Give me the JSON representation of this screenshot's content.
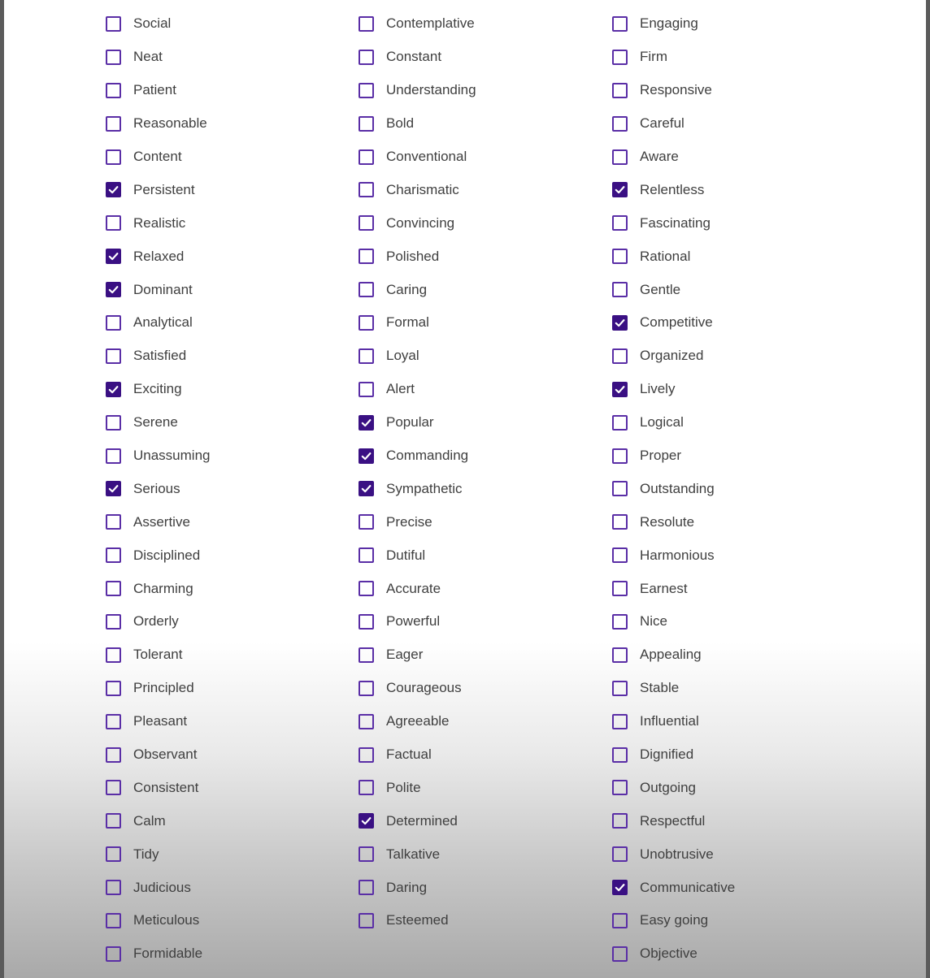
{
  "checklist": {
    "columns": [
      {
        "items": [
          {
            "label": "Social",
            "checked": false
          },
          {
            "label": "Neat",
            "checked": false
          },
          {
            "label": "Patient",
            "checked": false
          },
          {
            "label": "Reasonable",
            "checked": false
          },
          {
            "label": "Content",
            "checked": false
          },
          {
            "label": "Persistent",
            "checked": true
          },
          {
            "label": "Realistic",
            "checked": false
          },
          {
            "label": "Relaxed",
            "checked": true
          },
          {
            "label": "Dominant",
            "checked": true
          },
          {
            "label": "Analytical",
            "checked": false
          },
          {
            "label": "Satisfied",
            "checked": false
          },
          {
            "label": "Exciting",
            "checked": true
          },
          {
            "label": "Serene",
            "checked": false
          },
          {
            "label": "Unassuming",
            "checked": false
          },
          {
            "label": "Serious",
            "checked": true
          },
          {
            "label": "Assertive",
            "checked": false
          },
          {
            "label": "Disciplined",
            "checked": false
          },
          {
            "label": "Charming",
            "checked": false
          },
          {
            "label": "Orderly",
            "checked": false
          },
          {
            "label": "Tolerant",
            "checked": false
          },
          {
            "label": "Principled",
            "checked": false
          },
          {
            "label": "Pleasant",
            "checked": false
          },
          {
            "label": "Observant",
            "checked": false
          },
          {
            "label": "Consistent",
            "checked": false
          },
          {
            "label": "Calm",
            "checked": false
          },
          {
            "label": "Tidy",
            "checked": false
          },
          {
            "label": "Judicious",
            "checked": false
          },
          {
            "label": "Meticulous",
            "checked": false
          },
          {
            "label": "Formidable",
            "checked": false
          }
        ]
      },
      {
        "items": [
          {
            "label": "Contemplative",
            "checked": false
          },
          {
            "label": "Constant",
            "checked": false
          },
          {
            "label": "Understanding",
            "checked": false
          },
          {
            "label": "Bold",
            "checked": false
          },
          {
            "label": "Conventional",
            "checked": false
          },
          {
            "label": "Charismatic",
            "checked": false
          },
          {
            "label": "Convincing",
            "checked": false
          },
          {
            "label": "Polished",
            "checked": false
          },
          {
            "label": "Caring",
            "checked": false
          },
          {
            "label": "Formal",
            "checked": false
          },
          {
            "label": "Loyal",
            "checked": false
          },
          {
            "label": "Alert",
            "checked": false
          },
          {
            "label": "Popular",
            "checked": true
          },
          {
            "label": "Commanding",
            "checked": true
          },
          {
            "label": "Sympathetic",
            "checked": true
          },
          {
            "label": "Precise",
            "checked": false
          },
          {
            "label": "Dutiful",
            "checked": false
          },
          {
            "label": "Accurate",
            "checked": false
          },
          {
            "label": "Powerful",
            "checked": false
          },
          {
            "label": "Eager",
            "checked": false
          },
          {
            "label": "Courageous",
            "checked": false
          },
          {
            "label": "Agreeable",
            "checked": false
          },
          {
            "label": "Factual",
            "checked": false
          },
          {
            "label": "Polite",
            "checked": false
          },
          {
            "label": "Determined",
            "checked": true
          },
          {
            "label": "Talkative",
            "checked": false
          },
          {
            "label": "Daring",
            "checked": false
          },
          {
            "label": "Esteemed",
            "checked": false
          }
        ]
      },
      {
        "items": [
          {
            "label": "Engaging",
            "checked": false
          },
          {
            "label": "Firm",
            "checked": false
          },
          {
            "label": "Responsive",
            "checked": false
          },
          {
            "label": "Careful",
            "checked": false
          },
          {
            "label": "Aware",
            "checked": false
          },
          {
            "label": "Relentless",
            "checked": true
          },
          {
            "label": "Fascinating",
            "checked": false
          },
          {
            "label": "Rational",
            "checked": false
          },
          {
            "label": "Gentle",
            "checked": false
          },
          {
            "label": "Competitive",
            "checked": true
          },
          {
            "label": "Organized",
            "checked": false
          },
          {
            "label": "Lively",
            "checked": true
          },
          {
            "label": "Logical",
            "checked": false
          },
          {
            "label": "Proper",
            "checked": false
          },
          {
            "label": "Outstanding",
            "checked": false
          },
          {
            "label": "Resolute",
            "checked": false
          },
          {
            "label": "Harmonious",
            "checked": false
          },
          {
            "label": "Earnest",
            "checked": false
          },
          {
            "label": "Nice",
            "checked": false
          },
          {
            "label": "Appealing",
            "checked": false
          },
          {
            "label": "Stable",
            "checked": false
          },
          {
            "label": "Influential",
            "checked": false
          },
          {
            "label": "Dignified",
            "checked": false
          },
          {
            "label": "Outgoing",
            "checked": false
          },
          {
            "label": "Respectful",
            "checked": false
          },
          {
            "label": "Unobtrusive",
            "checked": false
          },
          {
            "label": "Communicative",
            "checked": true
          },
          {
            "label": "Easy going",
            "checked": false
          },
          {
            "label": "Objective",
            "checked": false
          }
        ]
      }
    ]
  },
  "colors": {
    "checkbox_border": "#5a2ea6",
    "checkbox_fill": "#3a1083",
    "label_text": "#3f3f3f"
  },
  "icons": {
    "checked": "checkmark-icon"
  }
}
